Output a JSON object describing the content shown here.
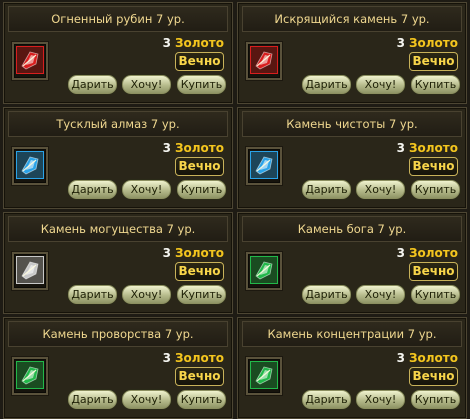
{
  "buttons": {
    "gift": "Дарить",
    "want": "Хочу!",
    "buy": "Купить"
  },
  "currency": "Золото",
  "colors": {
    "title_text": "#f0d890",
    "currency": "#f3c51e",
    "button_face": "#d8dcb0"
  },
  "items": [
    {
      "title": "Огненный рубин 7 ур.",
      "price": "3",
      "duration": "Вечно",
      "gem_icon": "red-gem-icon",
      "gem_color": "#d81e1e"
    },
    {
      "title": "Искрящийся камень 7 ур.",
      "price": "3",
      "duration": "Вечно",
      "gem_icon": "red-gem-icon",
      "gem_color": "#d81e1e"
    },
    {
      "title": "Тусклый алмаз 7 ур.",
      "price": "3",
      "duration": "Вечно",
      "gem_icon": "blue-gem-icon",
      "gem_color": "#2aa3e8"
    },
    {
      "title": "Камень чистоты 7 ур.",
      "price": "3",
      "duration": "Вечно",
      "gem_icon": "blue-gem-icon",
      "gem_color": "#2aa3e8"
    },
    {
      "title": "Камень могущества 7 ур.",
      "price": "3",
      "duration": "Вечно",
      "gem_icon": "silver-gem-icon",
      "gem_color": "#c8c8c8"
    },
    {
      "title": "Камень бога 7 ур.",
      "price": "3",
      "duration": "Вечно",
      "gem_icon": "green-gem-icon",
      "gem_color": "#22b84a"
    },
    {
      "title": "Камень проворства 7 ур.",
      "price": "3",
      "duration": "Вечно",
      "gem_icon": "green-gem-icon",
      "gem_color": "#22b84a"
    },
    {
      "title": "Камень концентрации 7 ур.",
      "price": "3",
      "duration": "Вечно",
      "gem_icon": "green-gem-icon",
      "gem_color": "#22b84a"
    }
  ]
}
